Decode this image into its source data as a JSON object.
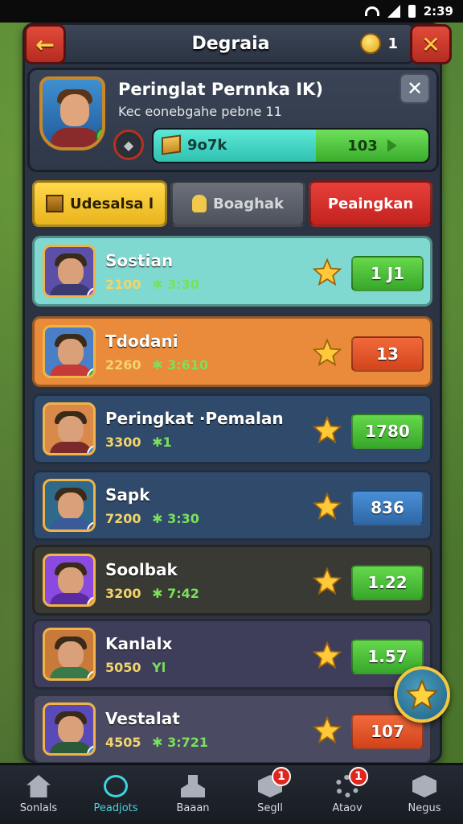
{
  "status": {
    "time": "2:39"
  },
  "header": {
    "title": "Degraia",
    "coin_count": "1",
    "back_glyph": "←",
    "close_glyph": "✕"
  },
  "profile": {
    "name": "Peringlat Pernnka IK)",
    "subtitle": "Kec eonebgahe pebne 11",
    "xp_label": "9o7k",
    "level_value": "103",
    "xp_progress": 0.6,
    "close_glyph": "✕"
  },
  "tabs": [
    {
      "label": "Udesalsa l"
    },
    {
      "label": "Boaghak"
    },
    {
      "label": "Peaingkan"
    }
  ],
  "rows": [
    {
      "name": "Sostian",
      "stat1": "2100",
      "stat2": "✱ 3:30",
      "score": "1 J1",
      "score_style": "green",
      "bg": "#7fd9d0",
      "avatar_bg": "#5b4fa8",
      "body": "#3a3a70",
      "badge": "#8a5de0"
    },
    {
      "name": "Tdodani",
      "stat1": "2260",
      "stat2": "✱ 3:610",
      "score": "13",
      "score_style": "orange",
      "bg": "#e98b3a",
      "avatar_bg": "#4a7fc8",
      "body": "#c73a3a",
      "badge": "#3fb23a"
    },
    {
      "name": "Peringkat ·Pemalan",
      "stat1": "3300",
      "stat2": "✱1",
      "score": "1780",
      "score_style": "green",
      "bg": "#2f4a6a",
      "avatar_bg": "#d98a4a",
      "body": "#7a2a2a",
      "badge": "#3a8ad8"
    },
    {
      "name": "Sapk",
      "stat1": "7200",
      "stat2": "✱ 3:30",
      "score": "836",
      "score_style": "blue",
      "bg": "#2f4a6a",
      "avatar_bg": "#2f6a8a",
      "body": "#3a5a9a",
      "badge": "#555c66"
    },
    {
      "name": "Soolbak",
      "stat1": "3200",
      "stat2": "✱ 7:42",
      "score": "1.22",
      "score_style": "green",
      "bg": "#3a3a34",
      "avatar_bg": "#8a4ae0",
      "body": "#5a2aa0",
      "badge": "#e0a23a"
    },
    {
      "name": "Kanlalx",
      "stat1": "5050",
      "stat2": "Yl",
      "score": "1.57",
      "score_style": "green",
      "bg": "#3e3e5a",
      "avatar_bg": "#c87a3a",
      "body": "#3a7a4a",
      "badge": "#e07a2a"
    },
    {
      "name": "Vestalat",
      "stat1": "4505",
      "stat2": "✱ 3:721",
      "score": "107",
      "score_style": "orange",
      "bg": "#4a4a62",
      "avatar_bg": "#5a4ab8",
      "body": "#2a5a3a",
      "badge": "#3a8ad8"
    }
  ],
  "nav": [
    {
      "label": "Sonlals",
      "icon": "home-icon"
    },
    {
      "label": "Peadjots",
      "icon": "ring-icon",
      "active": true
    },
    {
      "label": "Baaan",
      "icon": "anvil-icon"
    },
    {
      "label": "Segll",
      "icon": "hex-icon",
      "badge": "1"
    },
    {
      "label": "Ataov",
      "icon": "gear-icon",
      "badge": "1"
    },
    {
      "label": "Negus",
      "icon": "hex-icon"
    }
  ],
  "colors": {
    "accent": "#4ad1e0",
    "panel": "#2c3443",
    "gold": "#f4c642"
  }
}
